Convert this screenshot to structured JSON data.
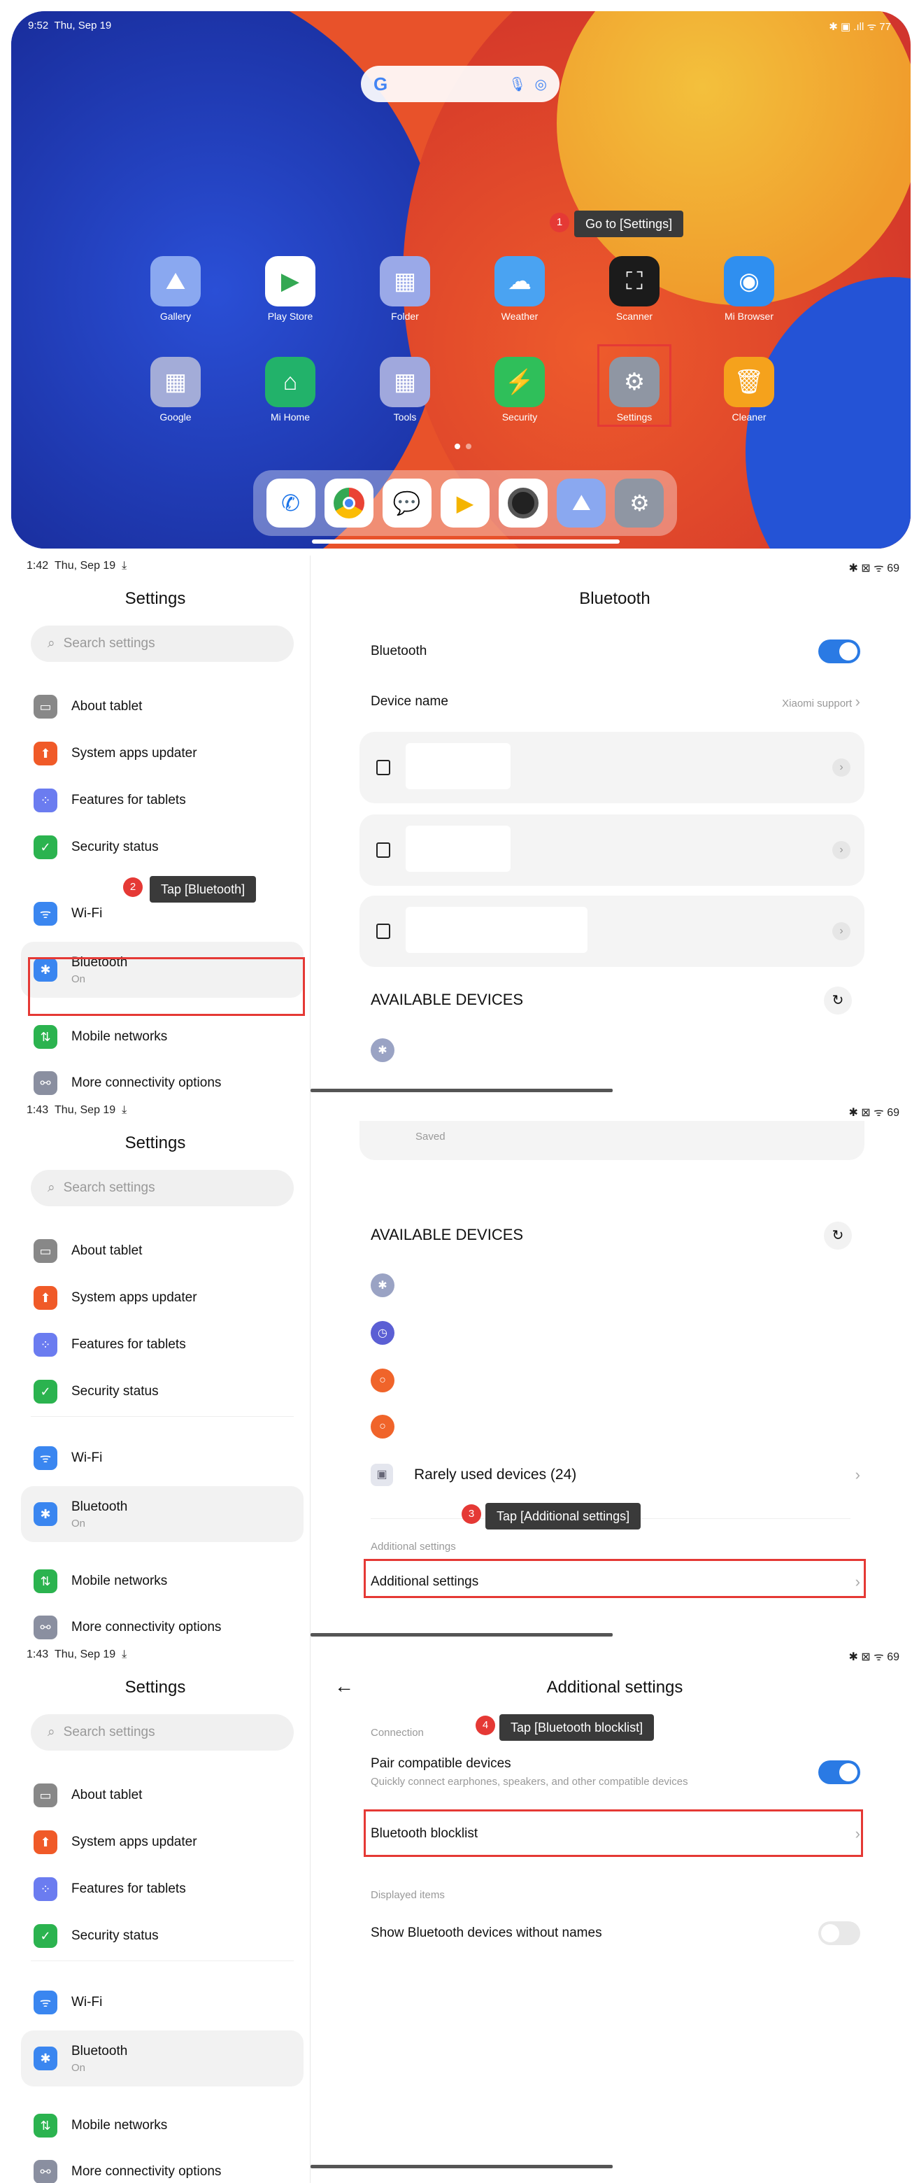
{
  "home": {
    "time": "9:52",
    "date": "Thu, Sep 19",
    "status_icons": "✱ ▣ .ıll ᯤ 77",
    "apps": [
      {
        "label": "Gallery",
        "icon": "gallery-icon",
        "color": "#8aa8f0"
      },
      {
        "label": "Play Store",
        "icon": "play-store-icon",
        "color": "#ffffff"
      },
      {
        "label": "Folder",
        "icon": "folder-icon",
        "color": "#9aa9e8"
      },
      {
        "label": "Weather",
        "icon": "weather-icon",
        "color": "#4aa3f2"
      },
      {
        "label": "Scanner",
        "icon": "scanner-icon",
        "color": "#1b1b1b"
      },
      {
        "label": "Mi Browser",
        "icon": "browser-icon",
        "color": "#2f8ff0"
      },
      {
        "label": "Google",
        "icon": "google-folder-icon",
        "color": "#a3acd8"
      },
      {
        "label": "Mi Home",
        "icon": "mi-home-icon",
        "color": "#22b26a"
      },
      {
        "label": "Tools",
        "icon": "tools-folder-icon",
        "color": "#a0a8dd"
      },
      {
        "label": "Security",
        "icon": "security-icon",
        "color": "#2fbf5a"
      },
      {
        "label": "Settings",
        "icon": "settings-icon",
        "color": "#8f96a3"
      },
      {
        "label": "Cleaner",
        "icon": "cleaner-icon",
        "color": "#f5a21c"
      }
    ],
    "dock": [
      "phone-icon",
      "chrome-icon",
      "messages-icon",
      "play-games-icon",
      "camera-icon",
      "gallery-icon",
      "settings-icon"
    ]
  },
  "steps": [
    {
      "n": "1",
      "text": "Go to [Settings]"
    },
    {
      "n": "2",
      "text": "Tap [Bluetooth]"
    },
    {
      "n": "3",
      "text": "Tap [Additional settings]"
    },
    {
      "n": "4",
      "text": "Tap [Bluetooth blocklist]"
    }
  ],
  "panels": [
    {
      "time": "1:42",
      "date": "Thu, Sep 19"
    },
    {
      "time": "1:43",
      "date": "Thu, Sep 19"
    },
    {
      "time": "1:43",
      "date": "Thu, Sep 19"
    }
  ],
  "status_right": "✱ ⊠ ᯤ 69",
  "sidebar": {
    "title": "Settings",
    "search_placeholder": "Search settings",
    "items": [
      {
        "label": "About tablet",
        "color": "#888"
      },
      {
        "label": "System apps updater",
        "color": "#f05a28"
      },
      {
        "label": "Features for tablets",
        "color": "#6b7cf0"
      },
      {
        "label": "Security status",
        "color": "#2bb34f"
      },
      {
        "label": "Wi-Fi",
        "color": "#3a86f0"
      },
      {
        "label": "Bluetooth",
        "sub": "On",
        "color": "#3a86f0"
      },
      {
        "label": "Mobile networks",
        "color": "#2bb34f"
      },
      {
        "label": "More connectivity options",
        "color": "#8a8fa0"
      }
    ]
  },
  "bluetooth": {
    "title": "Bluetooth",
    "toggle_label": "Bluetooth",
    "device_name_label": "Device name",
    "device_name_value": "Xiaomi support",
    "available": "AVAILABLE DEVICES",
    "saved": "Saved",
    "rarely_used": "Rarely used devices (24)",
    "additional_header": "Additional settings",
    "additional_row": "Additional settings"
  },
  "additional": {
    "title": "Additional settings",
    "connection": "Connection",
    "pair_title": "Pair compatible devices",
    "pair_sub": "Quickly connect earphones, speakers, and other compatible devices",
    "blocklist": "Bluetooth blocklist",
    "displayed": "Displayed items",
    "show_nameless": "Show Bluetooth devices without names"
  }
}
